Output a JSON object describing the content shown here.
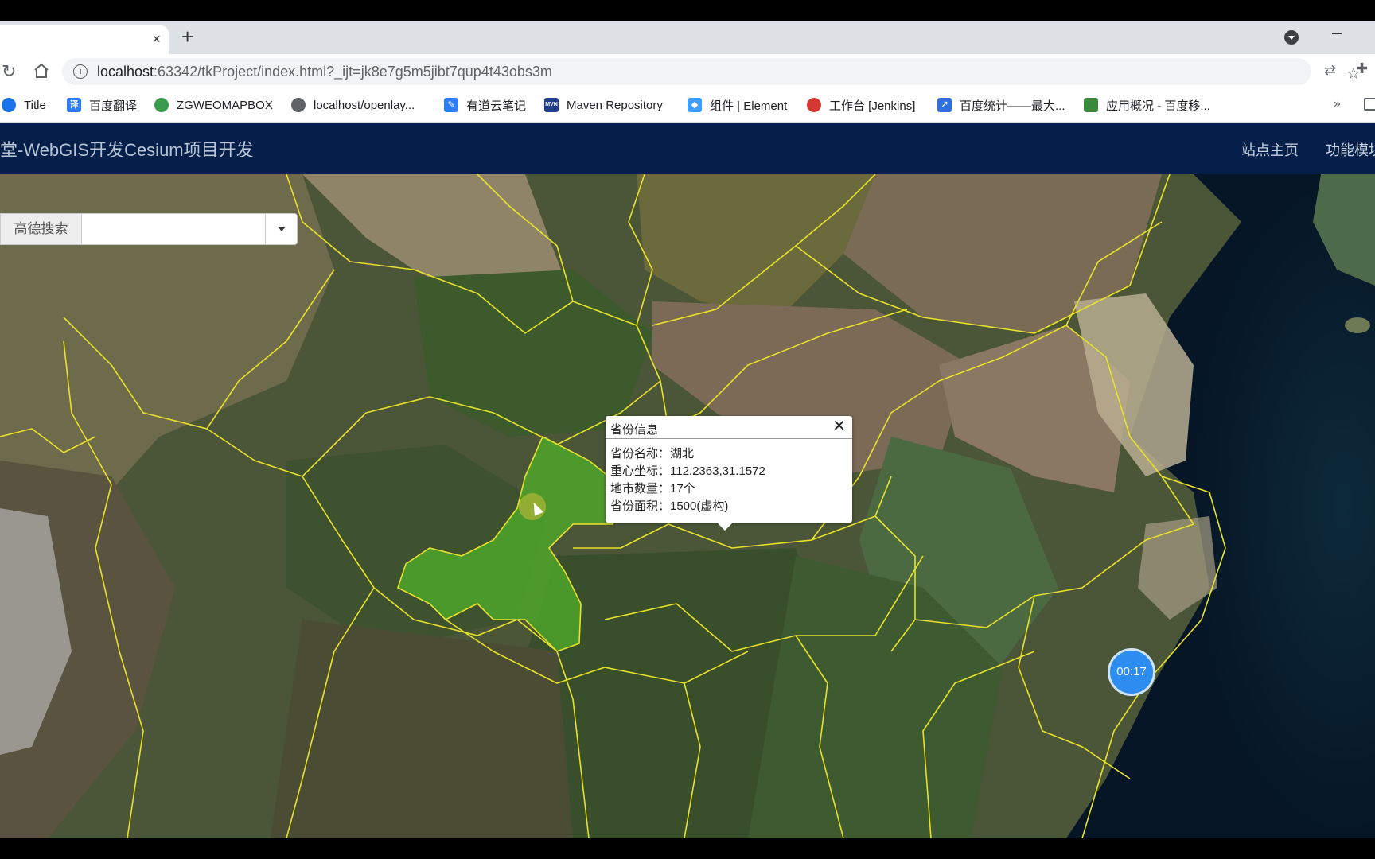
{
  "browser": {
    "tab_close": "×",
    "new_tab": "+",
    "minimize": "–",
    "url_host": "localhost",
    "url_rest": ":63342/tkProject/index.html?_ijt=jk8e7g5m5jibt7qup4t43obs3m",
    "bookmarks": [
      {
        "label": "Title",
        "icon": "globe-icon",
        "color": "#1a73e8"
      },
      {
        "label": "百度翻译",
        "icon": "translate-icon",
        "color": "#2b7cf6"
      },
      {
        "label": "ZGWEOMAPBOX",
        "icon": "globe-icon",
        "color": "#3a9b4a"
      },
      {
        "label": "localhost/openlay...",
        "icon": "globe-icon",
        "color": "#5f6368"
      },
      {
        "label": "有道云笔记",
        "icon": "note-icon",
        "color": "#2f7df5"
      },
      {
        "label": "Maven Repository",
        "icon": "maven-icon",
        "color": "#1f3f8a"
      },
      {
        "label": "组件 | Element",
        "icon": "element-icon",
        "color": "#409eff"
      },
      {
        "label": "工作台 [Jenkins]",
        "icon": "jenkins-icon",
        "color": "#d33833"
      },
      {
        "label": "百度统计——最大...",
        "icon": "chart-icon",
        "color": "#2f6fe0"
      },
      {
        "label": "应用概况 - 百度移...",
        "icon": "app-icon",
        "color": "#3b8a3b"
      }
    ],
    "bookmarks_more": "»"
  },
  "navbar": {
    "brand": "堂-WebGIS开发Cesium项目开发",
    "items": [
      "站点主页",
      "功能模块"
    ]
  },
  "search": {
    "label": "高德搜索",
    "value": ""
  },
  "popup": {
    "title": "省份信息",
    "close": "✕",
    "rows": [
      "省份名称：湖北",
      "重心坐标：112.2363,31.1572",
      "地市数量：17个",
      "省份面积：1500(虚构)"
    ]
  },
  "timer": "00:17"
}
